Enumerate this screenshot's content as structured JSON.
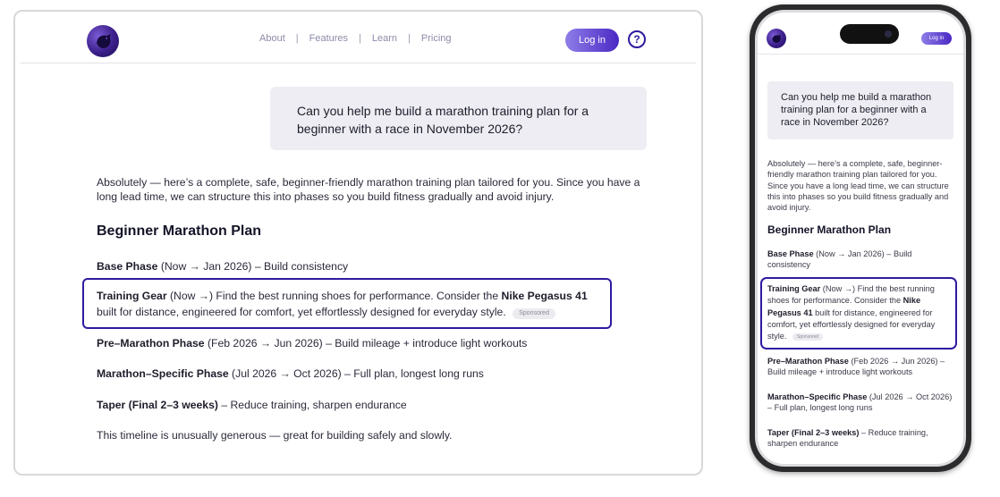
{
  "desktop": {
    "nav": [
      "About",
      "Features",
      "Learn",
      "Pricing"
    ],
    "nav_separator": "|",
    "login_label": "Log in",
    "help_label": "?",
    "user_message": "Can you help me build a marathon training plan for a beginner with a race in November 2026?",
    "intro": "Absolutely — here’s a complete, safe, beginner-friendly marathon training plan tailored for you. Since you have a long lead time, we can structure this into phases so you build fitness gradually and avoid injury.",
    "heading": "Beginner Marathon Plan",
    "base_label": "Base Phase",
    "base_text": " (Now → Jan 2026) – Build consistency",
    "ad_label": "Training Gear",
    "ad_text_1": " (Now →) Find the best running shoes for performance. Consider  the ",
    "ad_product": "Nike Pegasus 41",
    "ad_text_2": "built for distance, engineered for comfort, yet effortlessly designed for everyday style.",
    "sponsored": "Sponsored",
    "pre_label": "Pre–Marathon Phase",
    "pre_text": " (Feb 2026 → Jun 2026) – Build mileage + introduce light workouts",
    "specific_label": "Marathon–Specific Phase",
    "specific_text": " (Jul 2026 → Oct 2026) – Full plan, longest long runs",
    "taper_label": "Taper (Final 2–3 weeks)",
    "taper_text": " – Reduce training, sharpen endurance",
    "closing": "This timeline is unusually generous — great for building safely and slowly."
  },
  "mobile": {
    "login_label": "Log in",
    "user_message": "Can you help me build a marathon training plan for a beginner with a race in November 2026?",
    "intro": "Absolutely — here’s a complete, safe, beginner-friendly marathon training plan tailored for you. Since you have a long lead time, we can structure this into phases so you build fitness gradually and avoid injury.",
    "heading": "Beginner Marathon Plan",
    "base_label": "Base Phase",
    "base_text": " (Now → Jan 2026) – Build consistency",
    "ad_label": "Training Gear",
    "ad_text_1": " (Now →) Find the best running shoes for performance. Consider  the ",
    "ad_product": "Nike Pegasus 41",
    "ad_text_2": " built for distance, engineered for comfort, yet effortlessly designed for everyday style.",
    "sponsored": "Sponsored",
    "pre_label": "Pre–Marathon Phase",
    "pre_text": " (Feb 2026 → Jun 2026) – Build mileage + introduce light workouts",
    "specific_label": "Marathon–Specific Phase",
    "specific_text": " (Jul 2026 → Oct 2026) – Full plan, longest long runs",
    "taper_label": "Taper (Final 2–3 weeks)",
    "taper_text": " – Reduce training, sharpen endurance"
  },
  "colors": {
    "accent": "#2d1ba0",
    "login_gradient_start": "#8f7ee8",
    "login_gradient_end": "#4a28c4",
    "bubble_bg": "#ededf3"
  },
  "icons": {
    "logo": "bird-logo-icon",
    "help": "help-icon"
  }
}
